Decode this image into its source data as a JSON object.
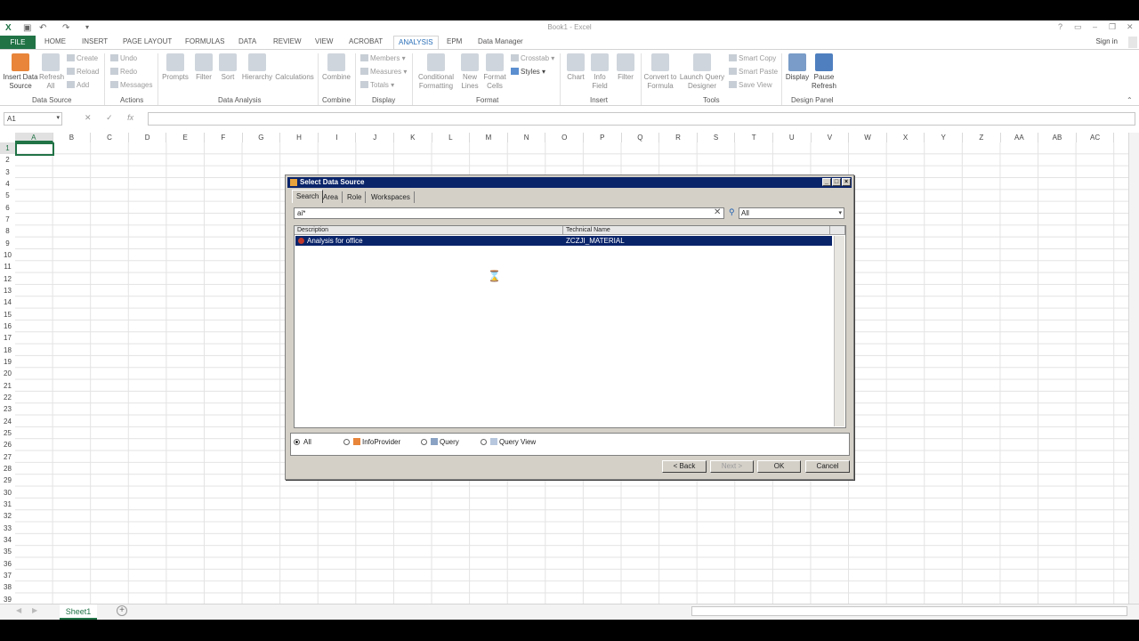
{
  "window": {
    "title": "Book1 - Excel",
    "help": "?",
    "signin": "Sign in"
  },
  "tabs": {
    "file": "FILE",
    "items": [
      "HOME",
      "INSERT",
      "PAGE LAYOUT",
      "FORMULAS",
      "DATA",
      "REVIEW",
      "VIEW",
      "ACROBAT",
      "ANALYSIS",
      "EPM",
      "Data Manager"
    ],
    "active": "ANALYSIS"
  },
  "ribbon": {
    "insert_data_source": "Insert Data Source",
    "refresh_all": "Refresh All",
    "create": "Create",
    "reload": "Reload",
    "add": "Add",
    "undo": "Undo",
    "redo": "Redo",
    "messages": "Messages",
    "prompts": "Prompts",
    "filter": "Filter",
    "sort": "Sort",
    "hierarchy": "Hierarchy",
    "calculations": "Calculations",
    "combine": "Combine",
    "members": "Members",
    "measures": "Measures",
    "totals": "Totals",
    "conditional_formatting": "Conditional Formatting",
    "new_lines": "New Lines",
    "format_cells": "Format Cells",
    "crosstab": "Crosstab",
    "styles": "Styles",
    "chart": "Chart",
    "info_field": "Info Field",
    "filter2": "Filter",
    "convert_to_formula": "Convert to Formula",
    "launch_query_designer": "Launch Query Designer",
    "smart_copy": "Smart Copy",
    "smart_paste": "Smart Paste",
    "save_view": "Save View",
    "display": "Display",
    "pause_refresh": "Pause Refresh",
    "groups": {
      "data_source": "Data Source",
      "actions": "Actions",
      "data_analysis": "Data Analysis",
      "combine": "Combine",
      "display": "Display",
      "format": "Format",
      "insert": "Insert",
      "tools": "Tools",
      "design_panel": "Design Panel"
    }
  },
  "formula_bar": {
    "name_box": "A1",
    "fx": "fx",
    "value": ""
  },
  "grid": {
    "columns": [
      "A",
      "B",
      "C",
      "D",
      "E",
      "F",
      "G",
      "H",
      "I",
      "J",
      "K",
      "L",
      "M",
      "N",
      "O",
      "P",
      "Q",
      "R",
      "S",
      "T",
      "U",
      "V",
      "W",
      "X",
      "Y",
      "Z",
      "AA",
      "AB",
      "AC"
    ],
    "rows": [
      "1",
      "2",
      "3",
      "4",
      "5",
      "6",
      "7",
      "8",
      "9",
      "10",
      "11",
      "12",
      "13",
      "14",
      "15",
      "16",
      "17",
      "18",
      "19",
      "20",
      "21",
      "22",
      "23",
      "24",
      "25",
      "26",
      "27",
      "28",
      "29",
      "30",
      "31",
      "32",
      "33",
      "34",
      "35",
      "36",
      "37",
      "38",
      "39"
    ]
  },
  "sheets": {
    "active": "Sheet1",
    "add": "+"
  },
  "dialog": {
    "title": "Select Data Source",
    "tabs": [
      "Search",
      "Area",
      "Role",
      "Workspaces"
    ],
    "search_value": "ai*",
    "scope": "All",
    "columns": [
      "Description",
      "Technical Name"
    ],
    "rows": [
      {
        "description": "Analysis for office",
        "technical_name": "ZCZJI_MATERIAL"
      }
    ],
    "filters": [
      "All",
      "InfoProvider",
      "Query",
      "Query View"
    ],
    "filter_selected": "All",
    "buttons": {
      "back": "< Back",
      "next": "Next >",
      "ok": "OK",
      "cancel": "Cancel"
    }
  }
}
